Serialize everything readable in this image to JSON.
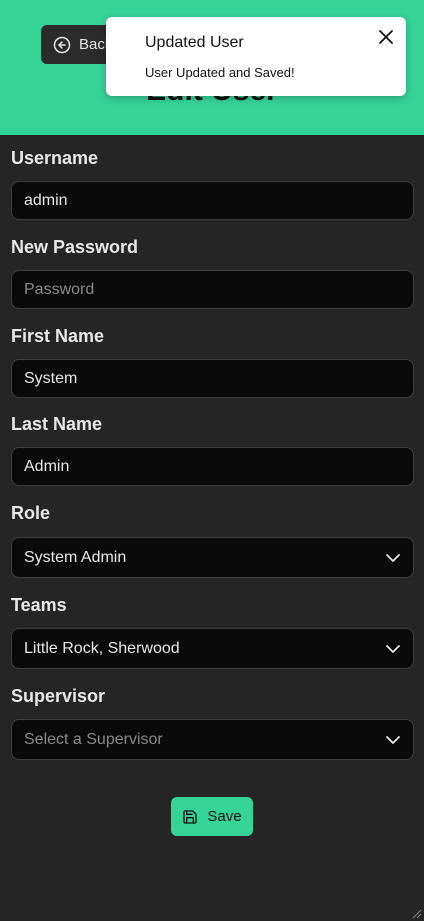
{
  "header": {
    "back_label": "Back",
    "title": "Edit User"
  },
  "toast": {
    "title": "Updated User",
    "message": "User Updated and Saved!"
  },
  "form": {
    "username": {
      "label": "Username",
      "value": "admin"
    },
    "password": {
      "label": "New Password",
      "placeholder": "Password"
    },
    "first_name": {
      "label": "First Name",
      "value": "System"
    },
    "last_name": {
      "label": "Last Name",
      "value": "Admin"
    },
    "role": {
      "label": "Role",
      "value": "System Admin"
    },
    "teams": {
      "label": "Teams",
      "value": "Little Rock, Sherwood"
    },
    "supervisor": {
      "label": "Supervisor",
      "placeholder": "Select a Supervisor"
    }
  },
  "save_label": "Save",
  "colors": {
    "accent": "#36d399",
    "background": "#252525",
    "field_bg": "#0a0a0b"
  }
}
